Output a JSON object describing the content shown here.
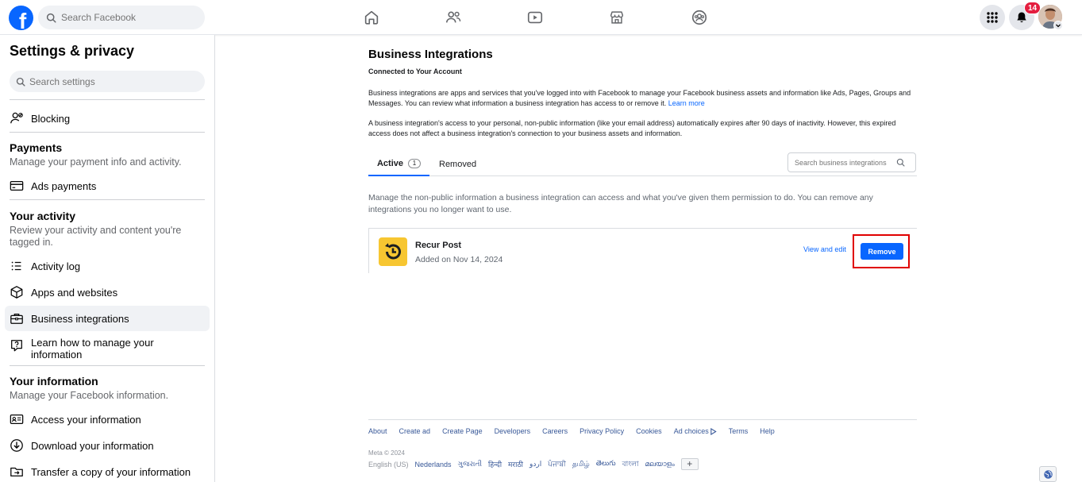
{
  "topbar": {
    "logo_letter": "f",
    "search_placeholder": "Search Facebook",
    "nav_icons": [
      "home-icon",
      "friends-icon",
      "video-icon",
      "marketplace-icon",
      "groups-icon"
    ],
    "notification_count": "14"
  },
  "sidebar": {
    "title": "Settings & privacy",
    "search_placeholder": "Search settings",
    "blocking": "Blocking",
    "payments": {
      "heading": "Payments",
      "subtitle": "Manage your payment info and activity.",
      "ads_payments": "Ads payments"
    },
    "activity": {
      "heading": "Your activity",
      "subtitle": "Review your activity and content you're tagged in.",
      "items": [
        "Activity log",
        "Apps and websites",
        "Business integrations",
        "Learn how to manage your information"
      ]
    },
    "information": {
      "heading": "Your information",
      "subtitle": "Manage your Facebook information.",
      "items": [
        "Access your information",
        "Download your information",
        "Transfer a copy of your information"
      ]
    }
  },
  "main": {
    "title": "Business Integrations",
    "subtitle": "Connected to Your Account",
    "para1": "Business integrations are apps and services that you've logged into with Facebook to manage your Facebook business assets and information like Ads, Pages, Groups and Messages. You can review what information a business integration has access to or remove it.",
    "learn_more": "Learn more",
    "para2": "A business integration's access to your personal, non-public information (like your email address) automatically expires after 90 days of inactivity. However, this expired access does not affect a business integration's connection to your business assets and information.",
    "tabs": {
      "active": "Active",
      "active_count": "1",
      "removed": "Removed"
    },
    "search_placeholder": "Search business integrations",
    "description": "Manage the non-public information a business integration can access and what you've given them permission to do. You can remove any integrations you no longer want to use.",
    "integration": {
      "name": "Recur Post",
      "added": "Added on Nov 14, 2024",
      "view_edit": "View and edit",
      "remove": "Remove"
    }
  },
  "footer": {
    "links": [
      "About",
      "Create ad",
      "Create Page",
      "Developers",
      "Careers",
      "Privacy Policy",
      "Cookies",
      "Ad choices",
      "Terms",
      "Help"
    ],
    "meta": "Meta © 2024",
    "current_language": "English (US)",
    "languages": [
      "Nederlands",
      "ગુજરાતી",
      "हिन्दी",
      "मराठी",
      "اردو",
      "ਪੰਜਾਬੀ",
      "தமிழ்",
      "తెలుగు",
      "বাংলা",
      "മലയാളം"
    ],
    "add_language": "+"
  },
  "colors": {
    "accent": "#0866ff",
    "highlight": "#e00000",
    "badge": "#e41e3f",
    "app_icon": "#f7c631"
  }
}
